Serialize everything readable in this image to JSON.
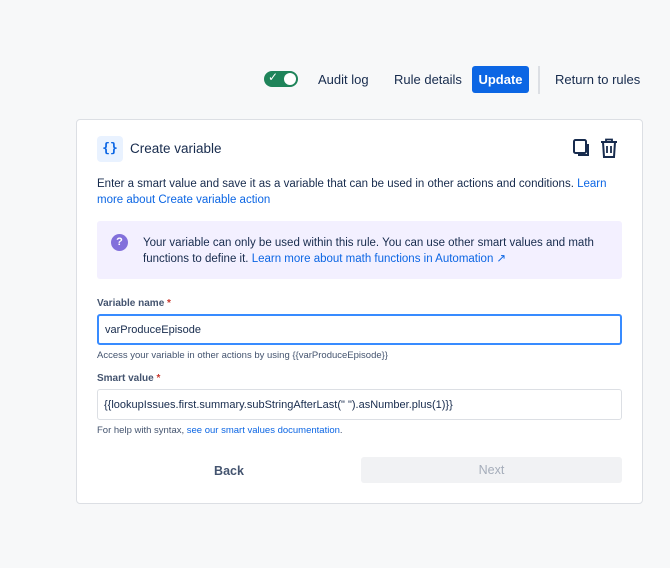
{
  "topbar": {
    "toggle_state": "on",
    "audit_log": "Audit log",
    "rule_details": "Rule details",
    "update": "Update",
    "return_to_rules": "Return to rules"
  },
  "card": {
    "icon_glyph": "{}",
    "title": "Create variable",
    "intro_text": "Enter a smart value and save it as a variable that can be used in other actions and conditions. ",
    "intro_link": "Learn more about Create variable action",
    "info_text": "Your variable can only be used within this rule. You can use other smart values and math functions to define it. ",
    "info_link": "Learn more about math functions in Automation ↗",
    "variable_name": {
      "label": "Variable name",
      "required_mark": "*",
      "value": "varProduceEpisode",
      "help": "Access your variable in other actions by using {{varProduceEpisode}}"
    },
    "smart_value": {
      "label": "Smart value",
      "required_mark": "*",
      "value": "{{lookupIssues.first.summary.subStringAfterLast(\" \").asNumber.plus(1)}}",
      "help_text": "For help with syntax, ",
      "help_link": "see our smart values documentation",
      "help_end": "."
    },
    "back": "Back",
    "next": "Next"
  },
  "colors": {
    "primary": "#0c66e4",
    "toggle_on": "#1f845a",
    "info_bg": "#f3f0ff",
    "info_icon": "#8270db",
    "page_bg": "#f7f8f9"
  }
}
